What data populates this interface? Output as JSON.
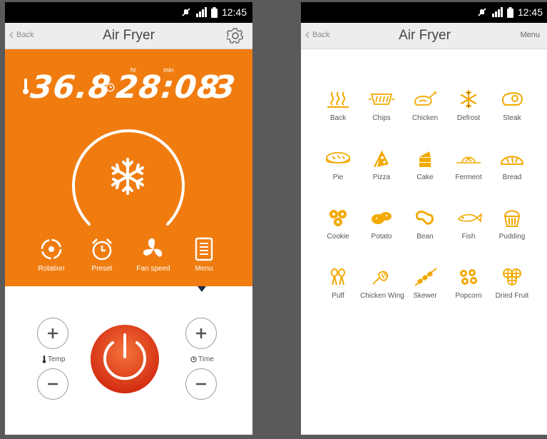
{
  "status_bar": {
    "time": "12:45",
    "icons": [
      "mute-icon",
      "signal-icon",
      "battery-icon"
    ]
  },
  "left_screen": {
    "header": {
      "back_label": "Back",
      "title": "Air Fryer",
      "settings_icon": "gear-icon"
    },
    "display": {
      "temperature": "36.8",
      "temperature_unit": "c",
      "time": "28:08",
      "hour_unit": "hr",
      "minute_unit": "min",
      "fan_level": "3",
      "icons": [
        "thermometer-icon",
        "clock-icon",
        "fan-icon"
      ]
    },
    "dial": {
      "icon": "snowflake-icon"
    },
    "modes": [
      {
        "label": "Rotation",
        "icon": "rotation-icon"
      },
      {
        "label": "Preset",
        "icon": "alarm-clock-icon"
      },
      {
        "label": "Fan speed",
        "icon": "fan-icon"
      },
      {
        "label": "Menu",
        "icon": "menu-list-icon"
      }
    ],
    "controls": {
      "temp_label": "Temp",
      "time_label": "Time",
      "power_icon": "power-icon"
    }
  },
  "right_screen": {
    "header": {
      "back_label": "Back",
      "title": "Air Fryer",
      "menu_label": "Menu"
    },
    "menu_items": [
      {
        "label": "Back",
        "icon": "heat-waves-icon"
      },
      {
        "label": "Chips",
        "icon": "chips-icon"
      },
      {
        "label": "Chicken",
        "icon": "chicken-icon"
      },
      {
        "label": "Defrost",
        "icon": "snowflake-icon"
      },
      {
        "label": "Steak",
        "icon": "steak-icon"
      },
      {
        "label": "Pie",
        "icon": "pie-icon"
      },
      {
        "label": "Pizza",
        "icon": "pizza-icon"
      },
      {
        "label": "Cake",
        "icon": "cake-icon"
      },
      {
        "label": "Ferment",
        "icon": "ferment-icon"
      },
      {
        "label": "Bread",
        "icon": "bread-icon"
      },
      {
        "label": "Cookie",
        "icon": "cookie-icon"
      },
      {
        "label": "Potato",
        "icon": "potato-icon"
      },
      {
        "label": "Bean",
        "icon": "bean-icon"
      },
      {
        "label": "Fish",
        "icon": "fish-icon"
      },
      {
        "label": "Pudding",
        "icon": "pudding-icon"
      },
      {
        "label": "Puff",
        "icon": "puff-icon"
      },
      {
        "label": "Chicken Wing",
        "icon": "chicken-wing-icon"
      },
      {
        "label": "Skewer",
        "icon": "skewer-icon"
      },
      {
        "label": "Popcorn",
        "icon": "popcorn-icon"
      },
      {
        "label": "Dried Fruit",
        "icon": "dried-fruit-icon"
      }
    ]
  },
  "colors": {
    "accent_orange": "#f07c10",
    "icon_yellow": "#f2a900",
    "power_red": "#e0361a",
    "background": "#5a5a5a"
  }
}
